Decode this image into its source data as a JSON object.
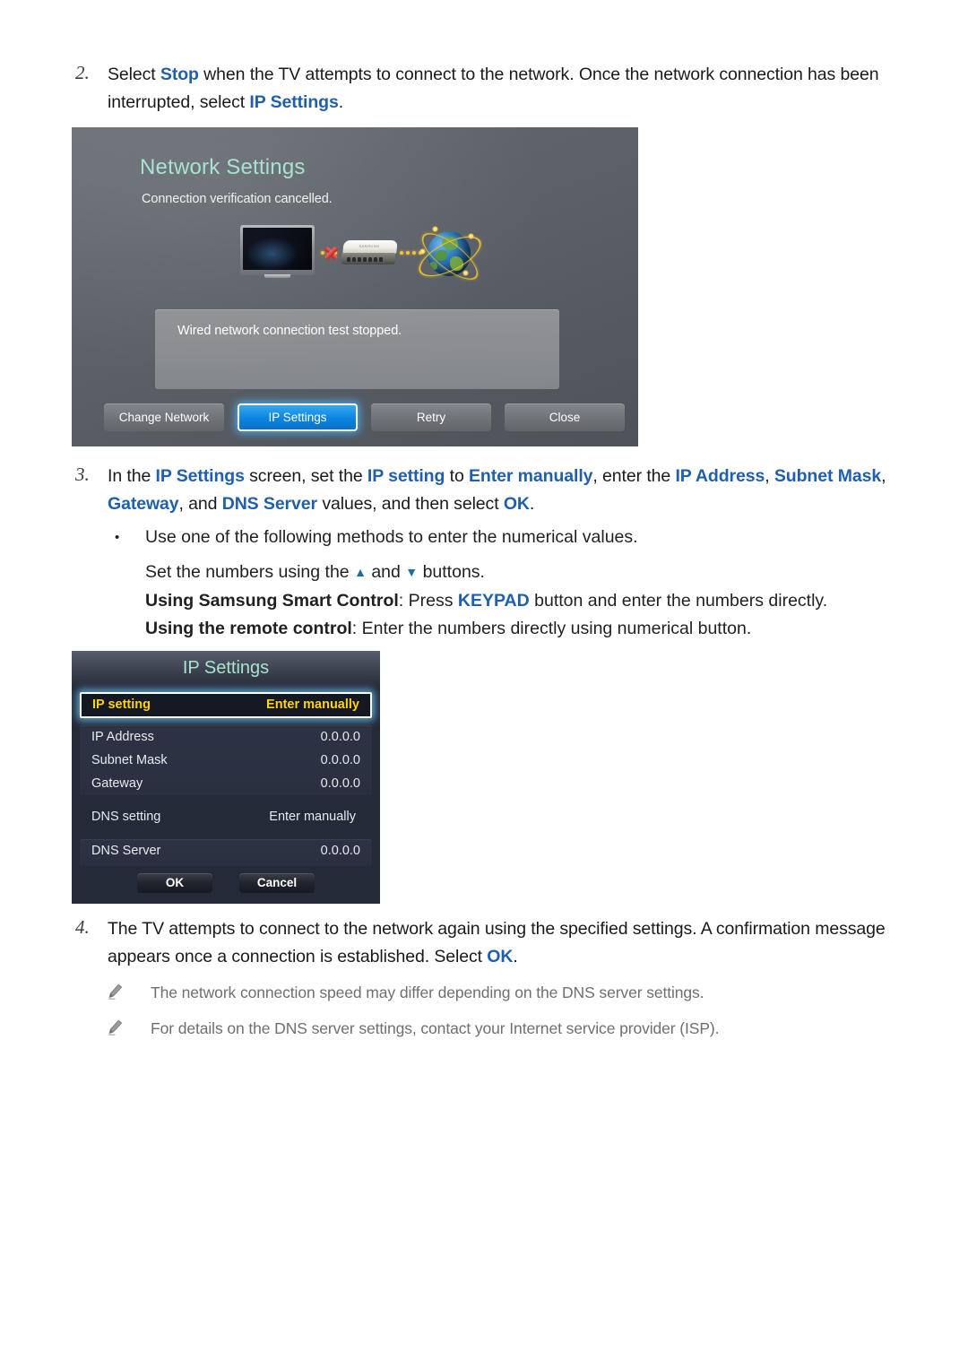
{
  "steps": [
    {
      "number": "2.",
      "parts": [
        {
          "t": "Select ",
          "s": "plain"
        },
        {
          "t": "Stop",
          "s": "hl-b"
        },
        {
          "t": " when the TV attempts to connect to the network. Once the network connection has been interrupted, select ",
          "s": "plain"
        },
        {
          "t": "IP Settings",
          "s": "hl-b"
        },
        {
          "t": ".",
          "s": "plain"
        }
      ]
    },
    {
      "number": "3.",
      "parts": [
        {
          "t": "In the ",
          "s": "plain"
        },
        {
          "t": "IP Settings",
          "s": "hl-b"
        },
        {
          "t": " screen, set the ",
          "s": "plain"
        },
        {
          "t": "IP setting",
          "s": "hl-b"
        },
        {
          "t": " to ",
          "s": "plain"
        },
        {
          "t": "Enter manually",
          "s": "hl-b"
        },
        {
          "t": ", enter the ",
          "s": "plain"
        },
        {
          "t": "IP Address",
          "s": "hl-b"
        },
        {
          "t": ", ",
          "s": "plain"
        },
        {
          "t": "Subnet Mask",
          "s": "hl-b"
        },
        {
          "t": ", ",
          "s": "plain"
        },
        {
          "t": "Gateway",
          "s": "hl-b"
        },
        {
          "t": ", and ",
          "s": "plain"
        },
        {
          "t": "DNS Server",
          "s": "hl-b"
        },
        {
          "t": " values, and then select ",
          "s": "plain"
        },
        {
          "t": "OK",
          "s": "hl-b"
        },
        {
          "t": ".",
          "s": "plain"
        }
      ]
    },
    {
      "number": "4.",
      "parts": [
        {
          "t": "The TV attempts to connect to the network again using the specified settings. A confirmation message appears once a connection is established. Select ",
          "s": "plain"
        },
        {
          "t": "OK",
          "s": "hl-b"
        },
        {
          "t": ".",
          "s": "plain"
        }
      ]
    }
  ],
  "bullets": {
    "dot": "•",
    "lead": "Use one of the following methods to enter the numerical values.",
    "lines": [
      {
        "parts": [
          {
            "t": "Set the numbers using the ",
            "s": "plain"
          },
          {
            "t": "▲",
            "s": "arrow-up"
          },
          {
            "t": " and ",
            "s": "plain"
          },
          {
            "t": "▼",
            "s": "arrow-dn"
          },
          {
            "t": " buttons.",
            "s": "plain"
          }
        ]
      },
      {
        "parts": [
          {
            "t": "Using Samsung Smart Control",
            "s": "bold"
          },
          {
            "t": ": Press ",
            "s": "plain"
          },
          {
            "t": "KEYPAD",
            "s": "hl-b"
          },
          {
            "t": " button and enter the numbers directly.",
            "s": "plain"
          }
        ]
      },
      {
        "parts": [
          {
            "t": "Using the remote control",
            "s": "bold"
          },
          {
            "t": ": Enter the numbers directly using numerical button.",
            "s": "plain"
          }
        ]
      }
    ]
  },
  "notes": [
    {
      "icon": "pencil-icon",
      "text": "The network connection speed may differ depending on the DNS server settings."
    },
    {
      "icon": "pencil-icon",
      "text": "For details on the DNS server settings, contact your Internet service provider (ISP)."
    }
  ],
  "network_settings_screen": {
    "title": "Network Settings",
    "subtitle": "Connection verification cancelled.",
    "message": "Wired network connection test stopped.",
    "diagram": {
      "tv_icon": "tv-icon",
      "router_icon": "router-icon",
      "router_brand": "SAMSUNG",
      "globe_icon": "globe-icon",
      "error_icon": "x-mark-icon"
    },
    "buttons": [
      {
        "label": "Change Network",
        "focused": false
      },
      {
        "label": "IP Settings",
        "focused": true
      },
      {
        "label": "Retry",
        "focused": false
      },
      {
        "label": "Close",
        "focused": false
      }
    ]
  },
  "ip_settings_screen": {
    "title": "IP Settings",
    "focused_row": {
      "key": "IP setting",
      "value": "Enter manually"
    },
    "address_rows": [
      {
        "key": "IP Address",
        "value": "0.0.0.0"
      },
      {
        "key": "Subnet Mask",
        "value": "0.0.0.0"
      },
      {
        "key": "Gateway",
        "value": "0.0.0.0"
      }
    ],
    "dns_setting": {
      "key": "DNS setting",
      "value": "Enter manually"
    },
    "dns_server": {
      "key": "DNS Server",
      "value": "0.0.0.0"
    },
    "buttons": [
      {
        "label": "OK"
      },
      {
        "label": "Cancel"
      }
    ]
  },
  "colors": {
    "link_blue": "#1f5fad",
    "tv_title_mint": "#a8e3cd",
    "focus_yellow": "#ffd400",
    "focus_blue": "#0b84e0",
    "note_gray": "#6f6f6f"
  }
}
